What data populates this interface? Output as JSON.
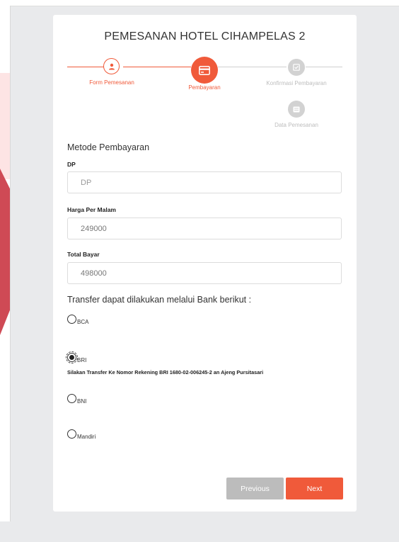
{
  "title": "PEMESANAN HOTEL CIHAMPELAS 2",
  "steps": [
    {
      "label": "Form Pemesanan",
      "state": "done",
      "icon": "user-icon"
    },
    {
      "label": "Pembayaran",
      "state": "active",
      "icon": "credit-card-icon"
    },
    {
      "label": "Konfirmasi Pembayaran",
      "state": "pending",
      "icon": "check-square-icon"
    },
    {
      "label": "Data Pemesanan",
      "state": "pending",
      "icon": "list-icon"
    }
  ],
  "section_title": "Metode Pembayaran",
  "fields": {
    "dp": {
      "label": "DP",
      "placeholder": "DP",
      "value": ""
    },
    "harga": {
      "label": "Harga Per Malam",
      "value": "249000"
    },
    "total": {
      "label": "Total Bayar",
      "value": "498000"
    }
  },
  "transfer_title": "Transfer dapat dilakukan melalui Bank berikut :",
  "banks": [
    {
      "label": "BCA",
      "selected": false
    },
    {
      "label": "BRI",
      "selected": true
    },
    {
      "label": "BNI",
      "selected": false
    },
    {
      "label": "Mandiri",
      "selected": false
    }
  ],
  "bank_info": "Silakan Transfer Ke Nomor Rekening BRI 1680-02-006245-2 an Ajeng Pursitasari",
  "buttons": {
    "previous": "Previous",
    "next": "Next"
  },
  "colors": {
    "accent": "#f05a3a",
    "inactive": "#cfcfcf",
    "button_disabled": "#bcbcbc"
  }
}
